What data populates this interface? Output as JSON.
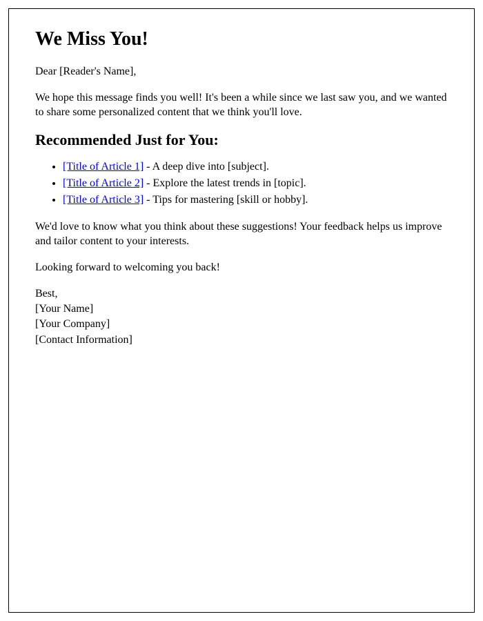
{
  "heading": "We Miss You!",
  "greeting": "Dear [Reader's Name],",
  "intro": "We hope this message finds you well! It's been a while since we last saw you, and we wanted to share some personalized content that we think you'll love.",
  "recommend_heading": "Recommended Just for You:",
  "articles": [
    {
      "title": "[Title of Article 1]",
      "desc": " - A deep dive into [subject]."
    },
    {
      "title": "[Title of Article 2]",
      "desc": " - Explore the latest trends in [topic]."
    },
    {
      "title": "[Title of Article 3]",
      "desc": " - Tips for mastering [skill or hobby]."
    }
  ],
  "feedback": "We'd love to know what you think about these suggestions! Your feedback helps us improve and tailor content to your interests.",
  "closing": "Looking forward to welcoming you back!",
  "signature": {
    "signoff": "Best,",
    "name": "[Your Name]",
    "company": "[Your Company]",
    "contact": "[Contact Information]"
  }
}
